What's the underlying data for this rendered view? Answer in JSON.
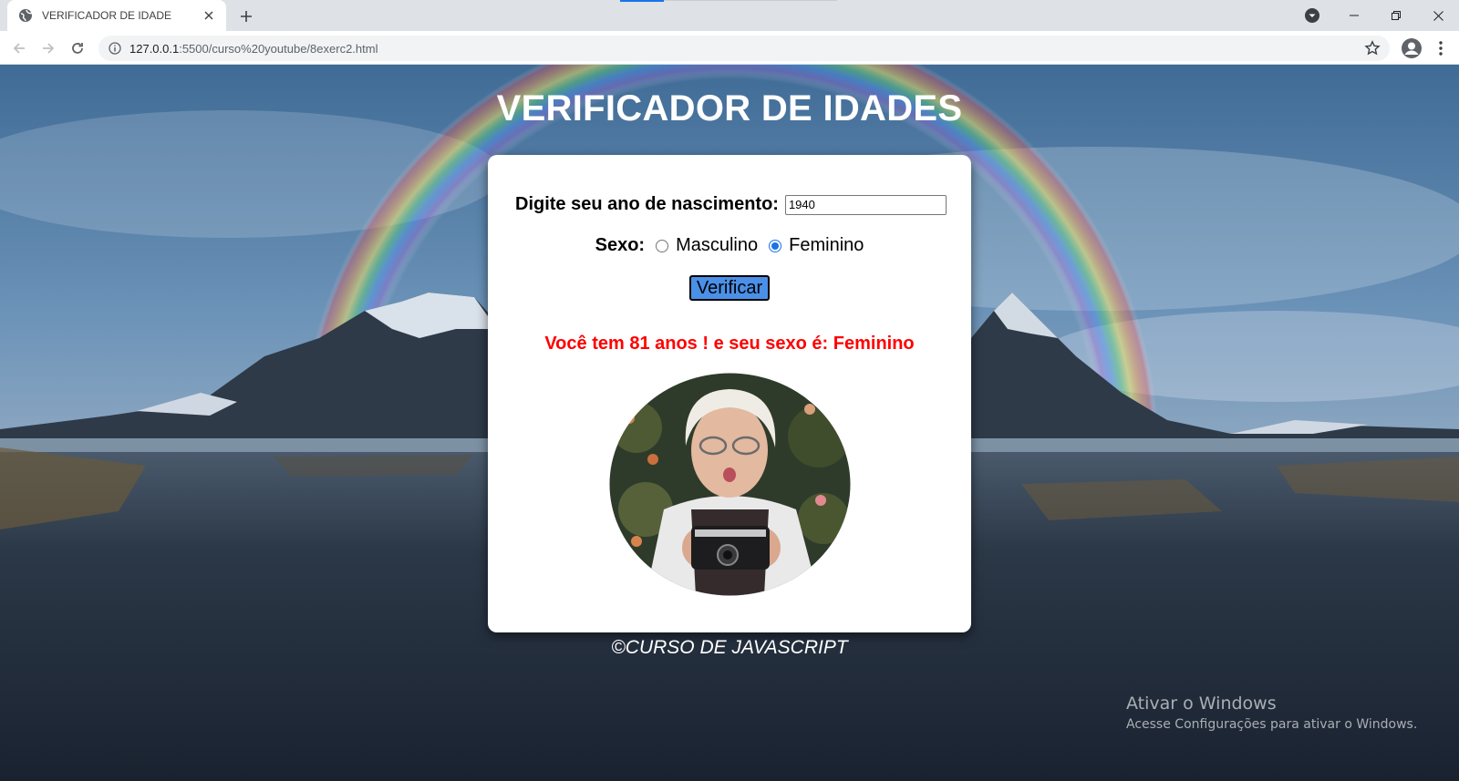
{
  "browser": {
    "tab_title": "VERIFICADOR DE IDADE",
    "url_host": "127.0.0.1",
    "url_rest": ":5500/curso%20youtube/8exerc2.html"
  },
  "page": {
    "title": "VERIFICADOR DE IDADES",
    "birth_year_label": "Digite seu ano de nascimento:",
    "birth_year_value": "1940",
    "sex_label": "Sexo:",
    "option_male": "Masculino",
    "option_female": "Feminino",
    "selected_option": "Feminino",
    "verify_button": "Verificar",
    "result_text": "Você tem 81 anos ! e seu sexo é: Feminino",
    "footer": "©CURSO DE JAVASCRIPT"
  },
  "os_watermark": {
    "line1": "Ativar o Windows",
    "line2": "Acesse Configurações para ativar o Windows."
  },
  "icons": {
    "favicon": "globe-icon",
    "close": "close-icon",
    "new_tab": "plus-icon",
    "back": "arrow-left-icon",
    "forward": "arrow-right-icon",
    "reload": "reload-icon",
    "info": "info-icon",
    "bookmark": "star-icon",
    "profile": "account-icon",
    "menu": "kebab-menu-icon"
  },
  "colors": {
    "result": "#ff0000",
    "button": "#4a90e8",
    "title": "#ffffff"
  }
}
